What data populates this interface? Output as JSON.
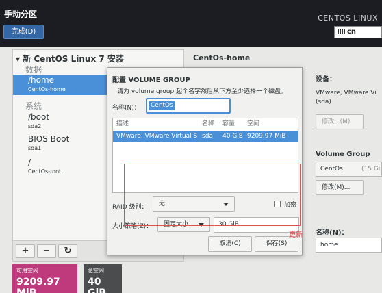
{
  "header": {
    "title": "手动分区",
    "done_label": "完成(D)",
    "product": "CENTOS LINUX",
    "keyboard": "cn"
  },
  "left_panel": {
    "tree_title": "▾ 新 CentOS Linux 7 安装",
    "section_data": "数据",
    "section_system": "系统",
    "mounts": [
      {
        "name": "/home",
        "device": "CentOs-home"
      },
      {
        "name": "/boot",
        "device": "sda2"
      },
      {
        "name": "BIOS Boot",
        "device": "sda1"
      },
      {
        "name": "/",
        "device": "CentOs-root"
      }
    ],
    "buttons": {
      "add": "+",
      "remove": "−",
      "refresh": "↻"
    }
  },
  "space": {
    "available_label": "可用空间",
    "available_value": "9209.97 MiB",
    "total_label": "总空间",
    "total_value": "40 GiB"
  },
  "right_panel": {
    "title": "CentOs-home",
    "device_label": "设备：",
    "device_value": "VMware, VMware Vi",
    "device_value2": "(sda)",
    "modify_device": "修改...(M)",
    "vg_label": "Volume Group",
    "vg_value": "CentOs",
    "vg_free": "(15 Gi",
    "modify_vg": "修改(M)...",
    "name_label": "名称(N)：",
    "name_value": "home"
  },
  "dialog": {
    "title": "配置 VOLUME GROUP",
    "instruction": "请为 volume group 起个名字然后从下方至少选择一个磁盘。",
    "name_label": "名称(N)：",
    "name_value": "CentOs",
    "columns": [
      "描述",
      "名称",
      "容量",
      "空间"
    ],
    "rows": [
      {
        "desc": "VMware, VMware Virtual S",
        "name": "sda",
        "capacity": "40 GiB",
        "free": "9209.97 MiB"
      }
    ],
    "raid_label": "RAID 级别：",
    "raid_value": "无",
    "encrypt_label": "加密",
    "size_policy_label": "大小策略(Z)：",
    "size_policy_value": "固定大小",
    "size_value": "30 GiB",
    "cancel_label": "取消(C)",
    "save_label": "保存(S)"
  },
  "annotation": {
    "text": "更新"
  },
  "colors": {
    "selection": "#4a90d9",
    "available": "#bf3a7c",
    "total": "#4b4c4e",
    "annotation": "#e03a3a"
  }
}
